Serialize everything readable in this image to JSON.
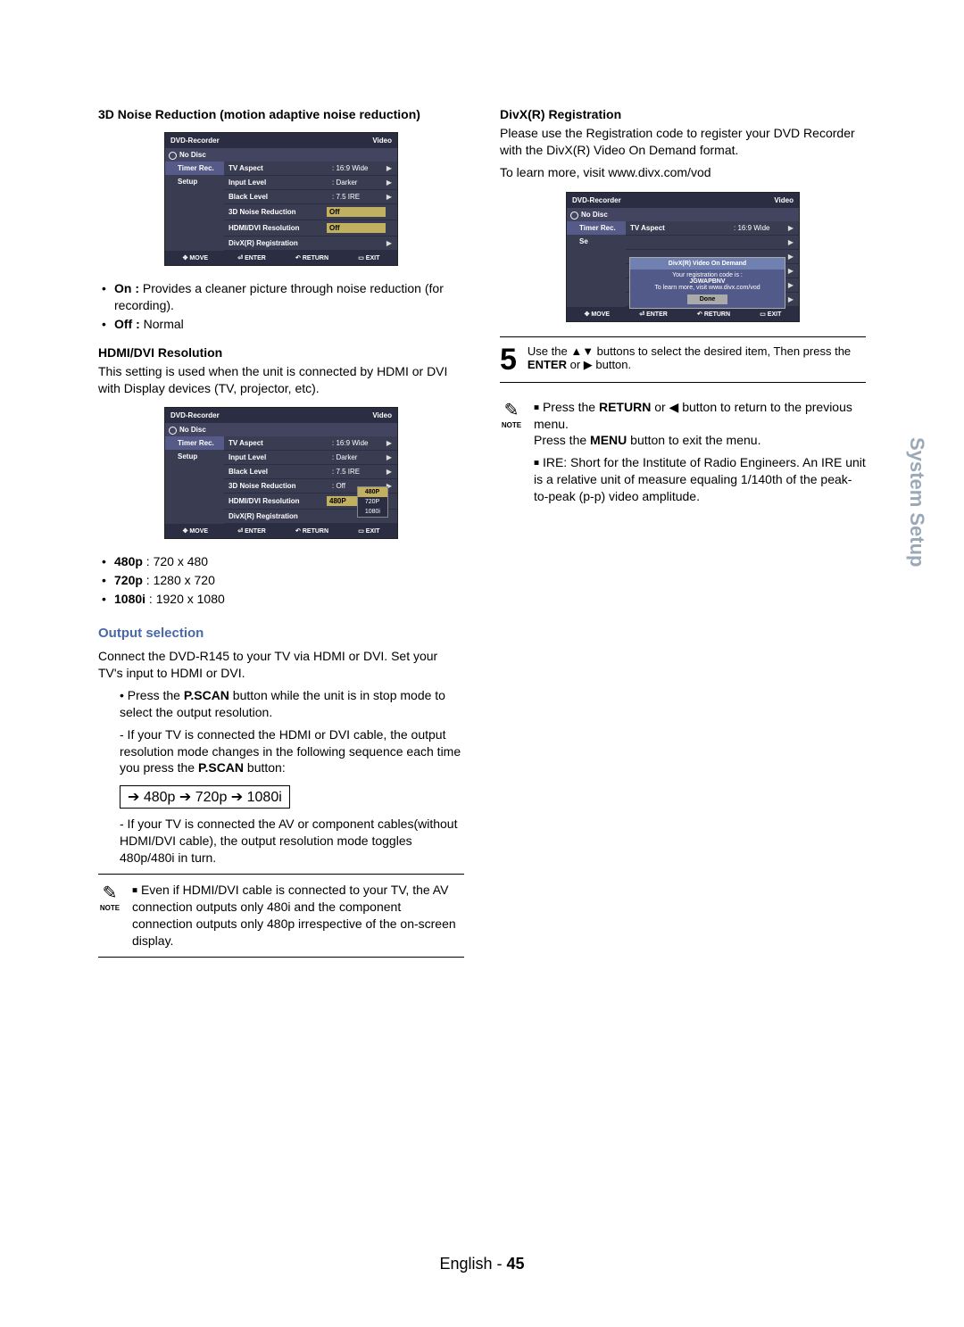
{
  "section_3d": {
    "heading": "3D Noise Reduction (motion adaptive noise reduction)",
    "osd": {
      "title": "DVD-Recorder",
      "mode": "Video",
      "status": "No Disc",
      "nav1": "Timer Rec.",
      "nav2": "Setup",
      "rows": {
        "tvAspect_k": "TV Aspect",
        "tvAspect_v": ": 16:9 Wide",
        "inputLevel_k": "Input Level",
        "inputLevel_v": ": Darker",
        "blackLevel_k": "Black Level",
        "blackLevel_v": ": 7.5 IRE",
        "nr_k": "3D Noise Reduction",
        "nr_v": "Off",
        "hdmi_k": "HDMI/DVI Resolution",
        "hdmi_v": "Off",
        "divx_k": "DivX(R) Registration",
        "divx_v": ""
      },
      "bot": {
        "move": "MOVE",
        "enter": "ENTER",
        "return": "RETURN",
        "exit": "EXIT"
      }
    },
    "bul_on_label": "On :",
    "bul_on": " Provides a cleaner picture through noise reduction (for recording).",
    "bul_off_label": "Off :",
    "bul_off": " Normal"
  },
  "section_hdmi": {
    "heading": "HDMI/DVI Resolution",
    "desc": "This setting is used when the unit is connected by HDMI or DVI with Display devices (TV, projector, etc).",
    "osd_rows": {
      "nr_v": ": Off",
      "hdmi_v": "480P",
      "opt1": "480P",
      "opt2": "720P",
      "opt3": "1080i"
    },
    "res1_label": "480p",
    "res1": " : 720 x 480",
    "res2_label": "720p",
    "res2": " : 1280 x 720",
    "res3_label": "1080i",
    "res3": " : 1920 x 1080"
  },
  "section_output": {
    "heading": "Output selection",
    "desc": "Connect the DVD-R145 to your TV via HDMI or DVI. Set your TV's input to HDMI or DVI.",
    "bul1a": "• Press the ",
    "bul1b": "P.SCAN",
    "bul1c": " button while the unit is in stop mode to select the output resolution.",
    "bul2a": "- If your TV is connected the HDMI or DVI cable, the output resolution mode changes in the following sequence each time you press the ",
    "bul2b": "P.SCAN",
    "bul2c": " button:",
    "sequence": "➔ 480p ➔ 720p ➔ 1080i",
    "bul3": "- If your TV is connected the AV or component cables(without HDMI/DVI cable), the output resolution mode toggles  480p/480i in turn.",
    "note": "Even if  HDMI/DVI cable is connected to your TV, the AV connection outputs only 480i and the component connection outputs only 480p irrespective of the on-screen display."
  },
  "section_divx": {
    "heading": "DivX(R) Registration",
    "desc1": "Please use the Registration code to register your DVD Recorder with the DivX(R) Video On Demand format.",
    "desc2": "To learn more, visit www.divx.com/vod",
    "osd_dialog": {
      "title": "DivX(R) Video On Demand",
      "line1": "Your registration code is :",
      "code": "JGWAPBNV",
      "line2": "To learn more, visit www.divx.com/vod",
      "btn": "Done"
    }
  },
  "step5": {
    "num": "5",
    "txt1": "Use the ▲▼ buttons to select the desired item, Then press the ",
    "txt2": "ENTER",
    "txt3": " or ▶ button."
  },
  "note_right": {
    "b1a": "Press the ",
    "b1b": "RETURN",
    "b1c": " or ◀ button to return to the previous menu.",
    "b2a": "Press the ",
    "b2b": "MENU",
    "b2c": " button to exit the menu.",
    "b3": "IRE: Short for the Institute of Radio Engineers. An IRE unit is a relative unit of measure equaling 1/140th of the peak-to-peak (p-p) video amplitude."
  },
  "labels": {
    "note": "NOTE",
    "sidebar": "System Setup",
    "footer_lang": "English - ",
    "footer_page": "45"
  }
}
